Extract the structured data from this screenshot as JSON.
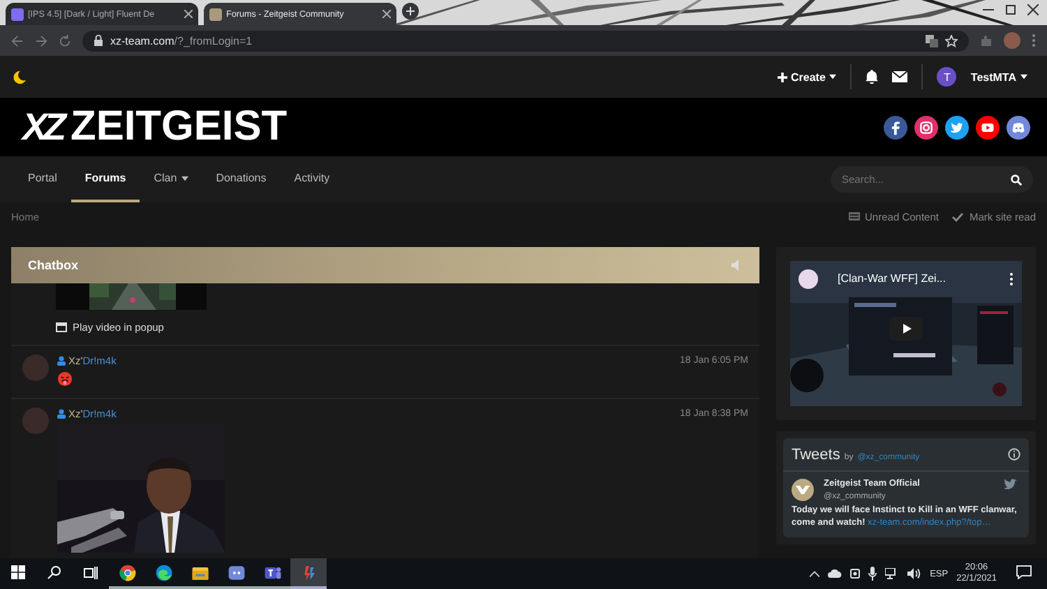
{
  "browser": {
    "tabs": [
      {
        "title": "[IPS 4.5] [Dark / Light] Fluent De",
        "selected": false
      },
      {
        "title": "Forums - Zeitgeist Community",
        "selected": true
      }
    ],
    "address": {
      "host": "xz-team.com",
      "path": "/?_fromLogin=1"
    }
  },
  "user_bar": {
    "create": "Create",
    "user_initial": "T",
    "user_name": "TestMTA"
  },
  "logo": {
    "mark": "XZ",
    "name": "ZEITGEIST"
  },
  "socials": [
    {
      "kind": "facebook"
    },
    {
      "kind": "instagram"
    },
    {
      "kind": "twitter"
    },
    {
      "kind": "youtube"
    },
    {
      "kind": "discord"
    }
  ],
  "nav": {
    "items": [
      {
        "label": "Portal",
        "selected": false,
        "dropdown": false
      },
      {
        "label": "Forums",
        "selected": true,
        "dropdown": false
      },
      {
        "label": "Clan",
        "selected": false,
        "dropdown": true
      },
      {
        "label": "Donations",
        "selected": false,
        "dropdown": false
      },
      {
        "label": "Activity",
        "selected": false,
        "dropdown": false
      }
    ],
    "search": {
      "placeholder": "Search..."
    }
  },
  "breadcrumb": {
    "home": "Home",
    "actions": [
      {
        "kind": "unread",
        "label": "Unread Content"
      },
      {
        "kind": "mark",
        "label": "Mark site read"
      }
    ]
  },
  "chatbox": {
    "title": "Chatbox",
    "popup_link": "Play video in popup",
    "messages": [
      {
        "tag": "Xz'",
        "name": "Dr!m4k",
        "time": "18 Jan 6:05 PM",
        "kind": "emoji"
      },
      {
        "tag": "Xz'",
        "name": "Dr!m4k",
        "time": "18 Jan 8:38 PM"
      }
    ]
  },
  "sidebar": {
    "video": {
      "title": "[Clan-War WFF] Zei..."
    },
    "tweets": {
      "title": "Tweets",
      "by": "by",
      "handle": "@xz_community",
      "tweet": {
        "author": "Zeitgeist Team Official",
        "handle": "@xz_community",
        "text": "Today we will face Instinct to Kill in an WFF clanwar, come and watch!",
        "link": "xz-team.com/index.php?/top…"
      }
    }
  },
  "taskbar": {
    "apps": [
      {
        "kind": "chrome",
        "active": false
      },
      {
        "kind": "edge",
        "active": false
      },
      {
        "kind": "explorer",
        "active": false
      },
      {
        "kind": "discord",
        "active": false
      },
      {
        "kind": "teams",
        "active": false
      },
      {
        "kind": "tool",
        "active": true
      }
    ],
    "language": "ESP",
    "time": "20:06",
    "date": "22/1/2021"
  }
}
